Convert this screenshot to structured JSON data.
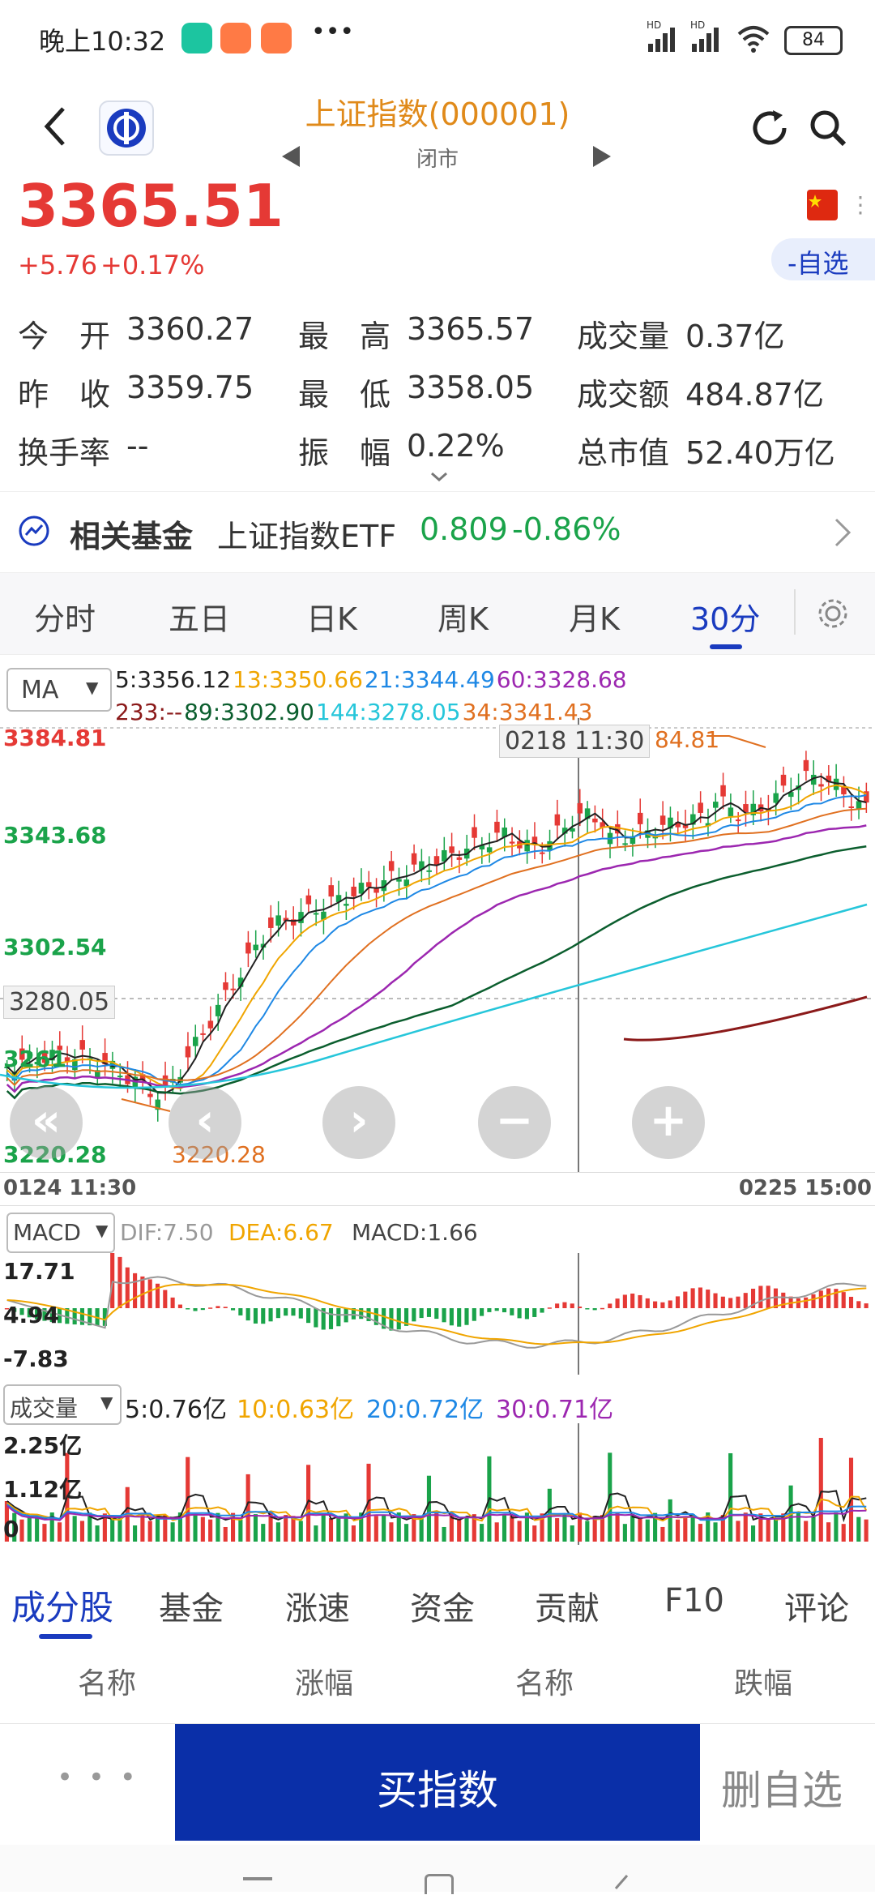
{
  "status": {
    "time": "晚上10:32",
    "dots": "•••",
    "battery": "84",
    "hd1": "HD",
    "hd2": "HD"
  },
  "header": {
    "title": "上证指数(000001)",
    "subtitle": "闭市"
  },
  "price": {
    "last": "3365.51",
    "change": "+5.76",
    "change_pct": "+0.17%",
    "watch_label": "-自选"
  },
  "stats": {
    "open_label": "今　开",
    "open": "3360.27",
    "high_label": "最　高",
    "high": "3365.57",
    "vol_label": "成交量",
    "vol": "0.37亿",
    "prev_label": "昨　收",
    "prev": "3359.75",
    "low_label": "最　低",
    "low": "3358.05",
    "amt_label": "成交额",
    "amt": "484.87亿",
    "turn_label": "换手率",
    "turn": "--",
    "amp_label": "振　幅",
    "amp": "0.22%",
    "cap_label": "总市值",
    "cap": "52.40万亿"
  },
  "fund": {
    "label": "相关基金",
    "name": "上证指数ETF",
    "price": "0.809",
    "pct": "-0.86%"
  },
  "chart_tabs": [
    "分时",
    "五日",
    "日K",
    "周K",
    "月K",
    "30分"
  ],
  "ma": {
    "selector": "MA",
    "items": [
      {
        "text": "5:3356.12",
        "color": "#222222"
      },
      {
        "text": "13:3350.66",
        "color": "#f0a500"
      },
      {
        "text": "21:3344.49",
        "color": "#1e88e5"
      },
      {
        "text": "60:3328.68",
        "color": "#9c27b0"
      }
    ],
    "items2": [
      {
        "text": "233:--",
        "color": "#8b1a1a"
      },
      {
        "text": "89:3302.90",
        "color": "#0b5e2e"
      },
      {
        "text": "144:3278.05",
        "color": "#26c6da"
      },
      {
        "text": "34:3341.43",
        "color": "#e07020"
      }
    ]
  },
  "kline": {
    "y_labels": [
      "3384.81",
      "3343.68",
      "3302.54",
      "3261",
      "3220.28"
    ],
    "crosshair_price": "3280.05",
    "crosshair_time": "0218 11:30",
    "max_mark": "84.81",
    "min_mark": "3220.28",
    "x_start": "0124 11:30",
    "x_end": "0225 15:00"
  },
  "macd": {
    "selector": "MACD",
    "dif": "DIF:7.50",
    "dea": "DEA:6.67",
    "macd": "MACD:1.66",
    "y_labels": [
      "17.71",
      "4.94",
      "-7.83"
    ]
  },
  "volume": {
    "selector": "成交量",
    "v5": "5:0.76亿",
    "v10": "10:0.63亿",
    "v20": "20:0.72亿",
    "v30": "30:0.71亿",
    "y_labels": [
      "2.25亿",
      "1.12亿",
      "0"
    ]
  },
  "bottom_tabs": [
    "成分股",
    "基金",
    "涨速",
    "资金",
    "贡献",
    "F10",
    "评论"
  ],
  "list_header": [
    "名称",
    "涨幅",
    "名称",
    "跌幅"
  ],
  "actions": {
    "more": "• • •",
    "buy": "买指数",
    "remove": "删自选"
  },
  "colors": {
    "up": "#e53935",
    "down": "#1aa34a",
    "accent": "#1a3bbf",
    "title": "#e08a1a",
    "buy_bg": "#0a2fa8"
  }
}
